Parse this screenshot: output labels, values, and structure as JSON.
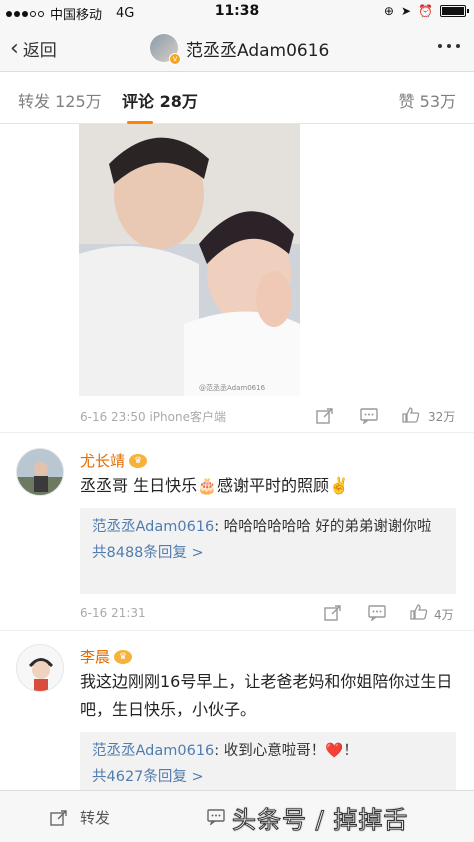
{
  "status": {
    "carrier": "中国移动",
    "network": "4G",
    "time": "11:38"
  },
  "nav": {
    "back_label": "返回",
    "title": "范丞丞Adam0616"
  },
  "tabs": {
    "repost": "转发 125万",
    "comments": "评论 28万",
    "likes": "赞 53万"
  },
  "post": {
    "time_source": "6-16 23:50 iPhone客户端",
    "image_watermark": "@范丞丞Adam0616",
    "like_count": "32万"
  },
  "comments": [
    {
      "name": "尤长靖",
      "text": "丞丞哥 生日快乐🎂感谢平时的照顾✌️",
      "reply_user": "范丞丞Adam0616",
      "reply_text": ": 哈哈哈哈哈哈 好的弟弟谢谢你啦",
      "reply_count": "共8488条回复 >",
      "time": "6-16 21:31",
      "like_count": "4万"
    },
    {
      "name": "李晨",
      "text": "我这边刚刚16号早上，让老爸老妈和你姐陪你过生日吧，生日快乐，小伙子。",
      "reply_user": "范丞丞Adam0616",
      "reply_text": ": 收到心意啦哥！❤️！",
      "reply_count": "共4627条回复 >"
    }
  ],
  "bottom": {
    "repost_label": "转发"
  },
  "watermark": "头条号 / 掉掉舌",
  "colors": {
    "accent": "#ff8200",
    "link": "#507daf",
    "name": "#e06b00"
  }
}
